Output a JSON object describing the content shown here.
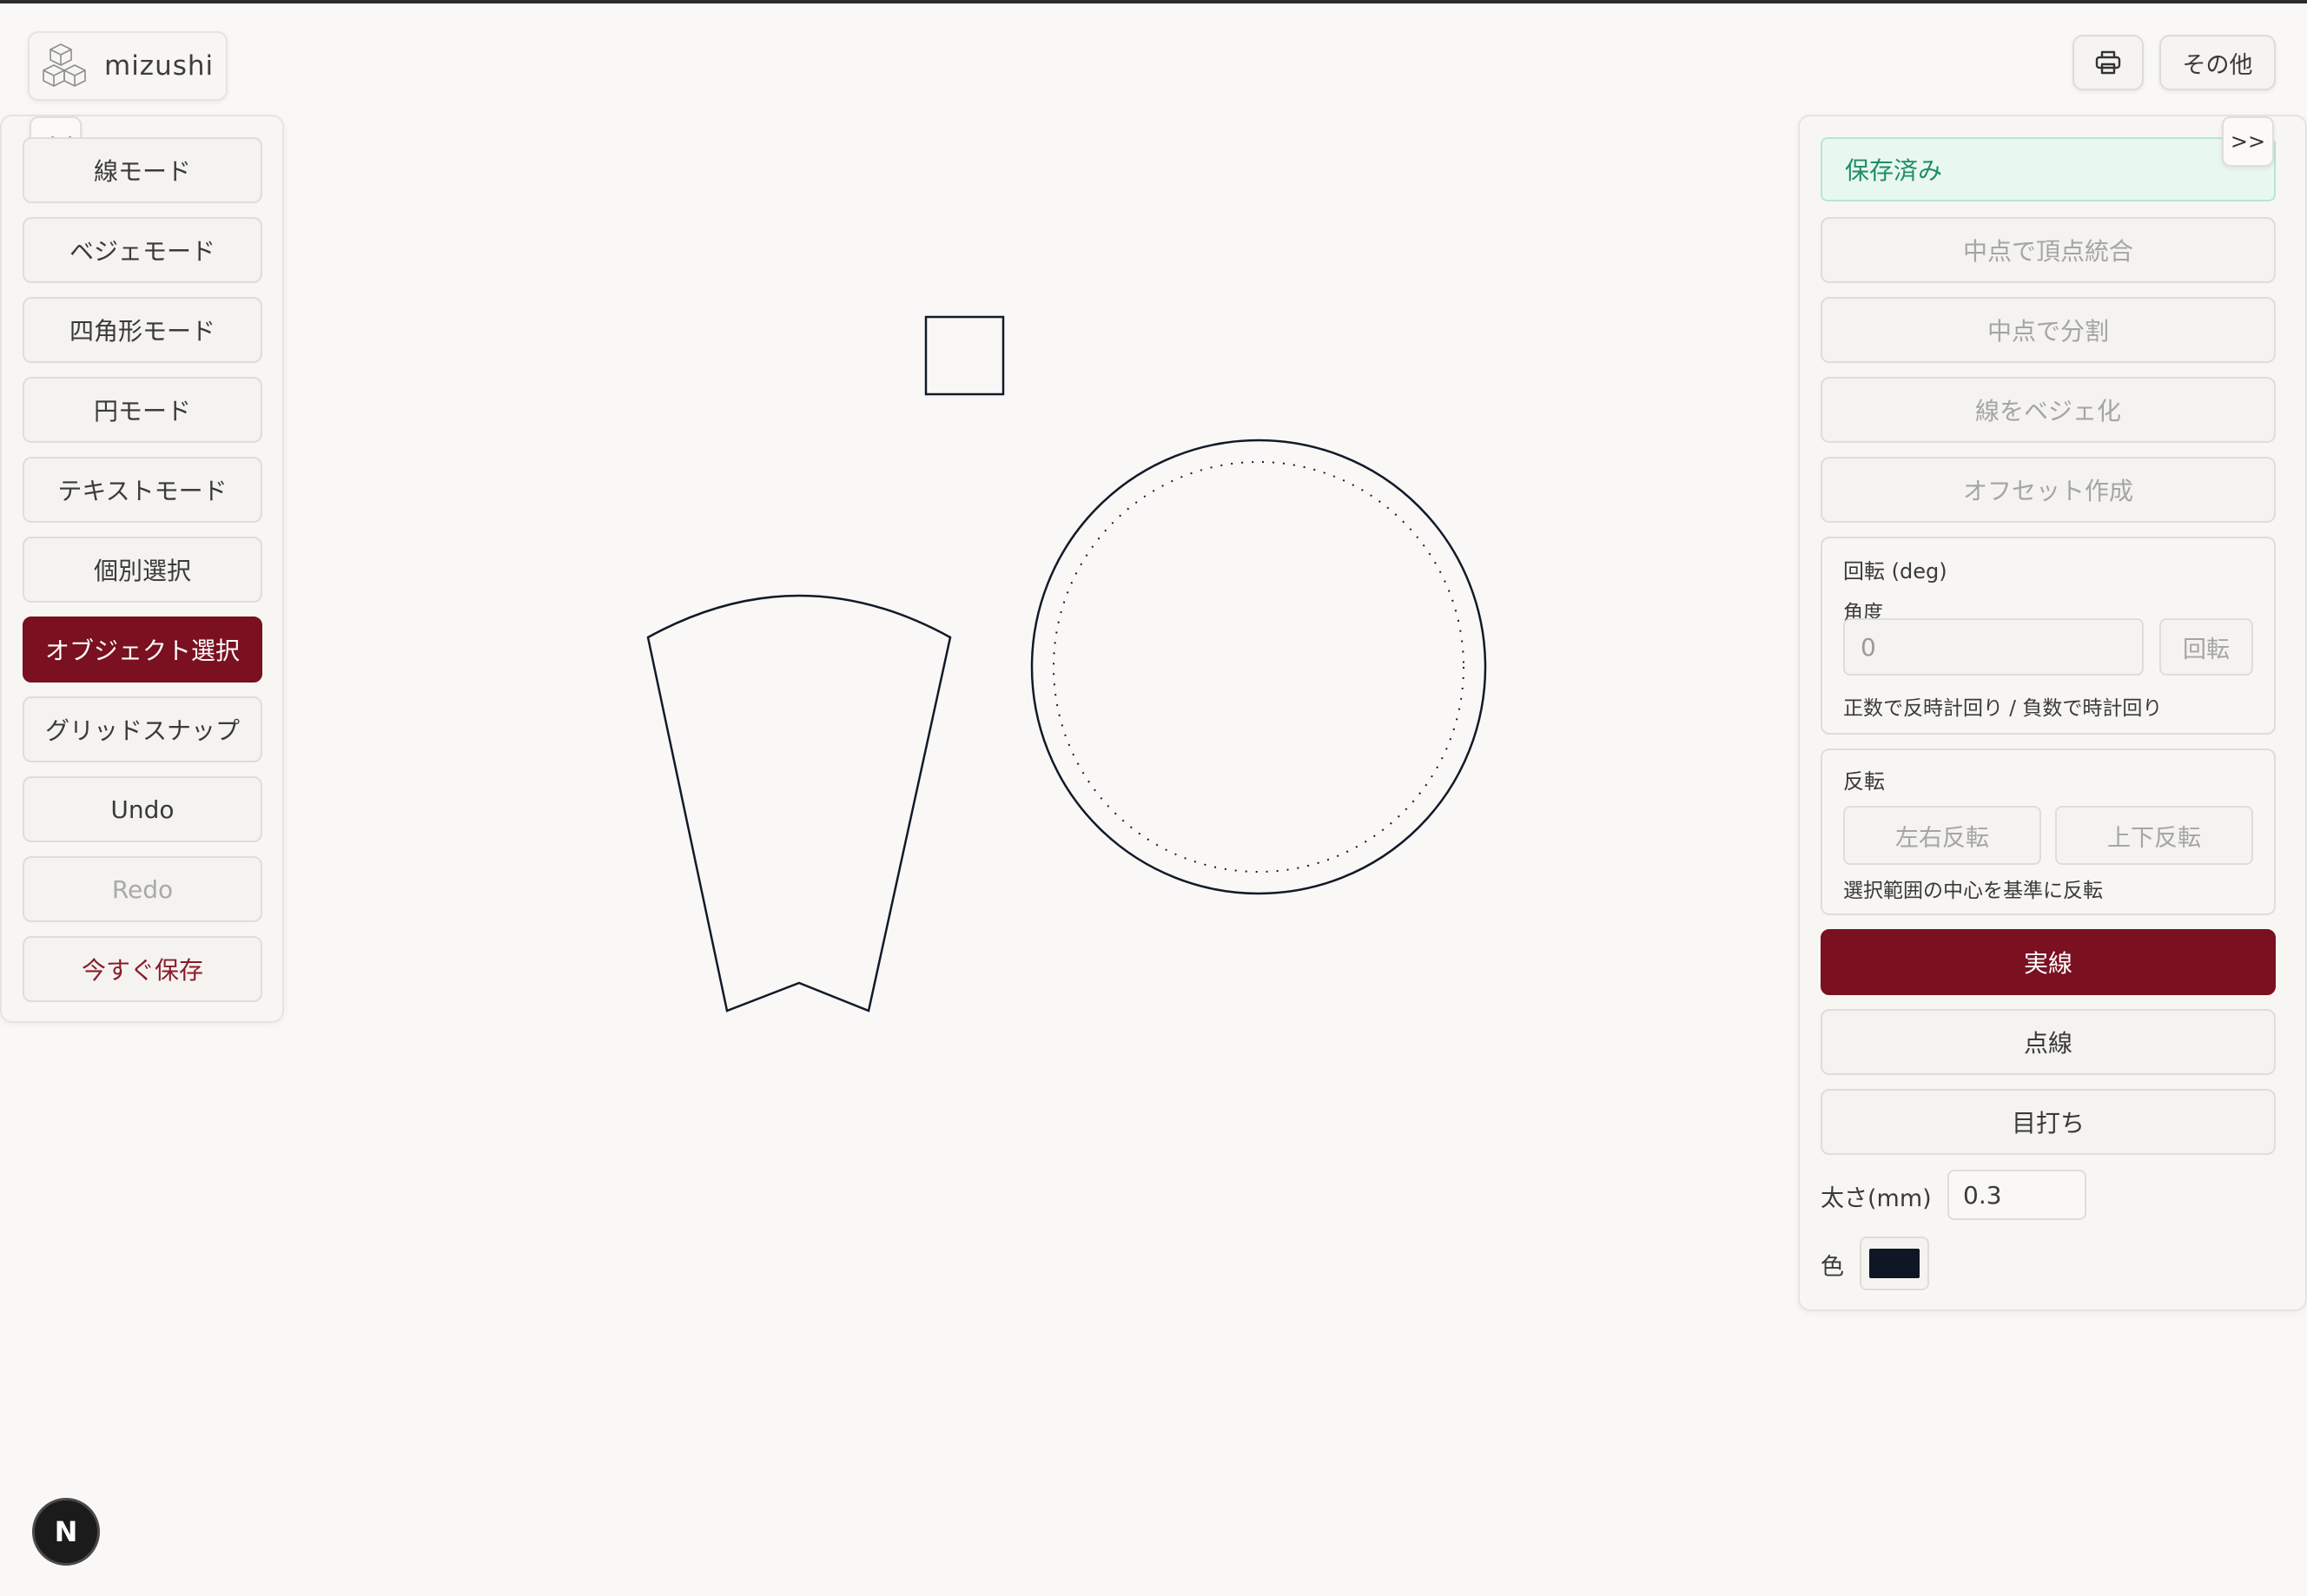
{
  "app": {
    "logo_text": "mizushi"
  },
  "header": {
    "more_label": "その他"
  },
  "left_panel": {
    "collapse_label": "<<",
    "tools": {
      "line": "線モード",
      "bezier": "ベジェモード",
      "rect": "四角形モード",
      "circle": "円モード",
      "text": "テキストモード",
      "individual": "個別選択",
      "object": "オブジェクト選択",
      "grid": "グリッドスナップ",
      "undo": "Undo",
      "redo": "Redo",
      "save": "今すぐ保存"
    }
  },
  "right_panel": {
    "collapse_label": ">>",
    "status": "保存済み",
    "actions": {
      "merge": "中点で頂点統合",
      "split": "中点で分割",
      "to_bezier": "線をベジェ化",
      "offset": "オフセット作成"
    },
    "rotate": {
      "title": "回転 (deg)",
      "angle_label": "角度",
      "angle_value": "0",
      "button": "回転",
      "hint": "正数で反時計回り / 負数で時計回り"
    },
    "flip": {
      "title": "反転",
      "horizontal": "左右反転",
      "vertical": "上下反転",
      "hint": "選択範囲の中心を基準に反転"
    },
    "line_styles": {
      "solid": "実線",
      "dashed": "点線",
      "stitch": "目打ち"
    },
    "thickness": {
      "label": "太さ(mm)",
      "value": "0.3"
    },
    "color": {
      "label": "色",
      "value": "#0f1626"
    }
  },
  "badge": {
    "label": "N"
  }
}
